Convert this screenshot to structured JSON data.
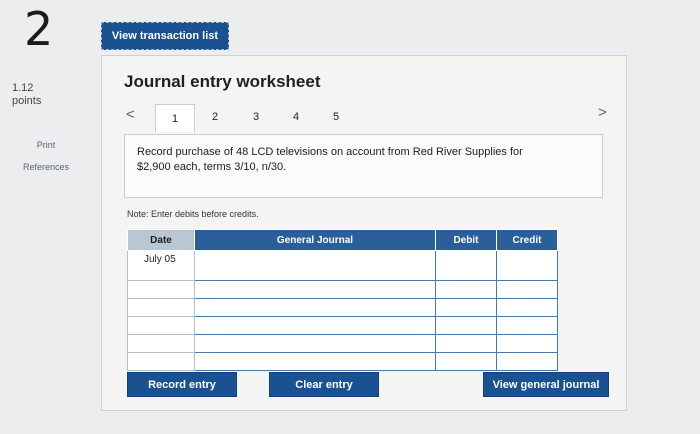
{
  "question": {
    "number": "2",
    "points": "1.12",
    "points_label": "points"
  },
  "sidebar": {
    "print_label": "Print",
    "references_label": "References"
  },
  "toolbar": {
    "view_transaction_list": "View transaction list"
  },
  "worksheet": {
    "title": "Journal entry worksheet",
    "prev_arrow": "<",
    "next_arrow": ">",
    "tabs": [
      {
        "label": "1",
        "active": true
      },
      {
        "label": "2",
        "active": false
      },
      {
        "label": "3",
        "active": false
      },
      {
        "label": "4",
        "active": false
      },
      {
        "label": "5",
        "active": false
      }
    ],
    "description_line1": "Record purchase of 48 LCD televisions on account from Red River Supplies for",
    "description_line2": "$2,900 each, terms 3/10, n/30.",
    "note": "Note: Enter debits before credits."
  },
  "journal_table": {
    "headers": {
      "date": "Date",
      "journal": "General Journal",
      "debit": "Debit",
      "credit": "Credit"
    },
    "rows": [
      {
        "date": "July 05",
        "account": "",
        "debit": "",
        "credit": ""
      },
      {
        "date": "",
        "account": "",
        "debit": "",
        "credit": ""
      },
      {
        "date": "",
        "account": "",
        "debit": "",
        "credit": ""
      },
      {
        "date": "",
        "account": "",
        "debit": "",
        "credit": ""
      },
      {
        "date": "",
        "account": "",
        "debit": "",
        "credit": ""
      },
      {
        "date": "",
        "account": "",
        "debit": "",
        "credit": ""
      }
    ]
  },
  "actions": {
    "record_entry": "Record entry",
    "clear_entry": "Clear entry",
    "view_general_journal": "View general journal"
  },
  "colors": {
    "button_blue": "#1a5190",
    "header_blue": "#2b5f9a",
    "background": "#ecedee"
  }
}
